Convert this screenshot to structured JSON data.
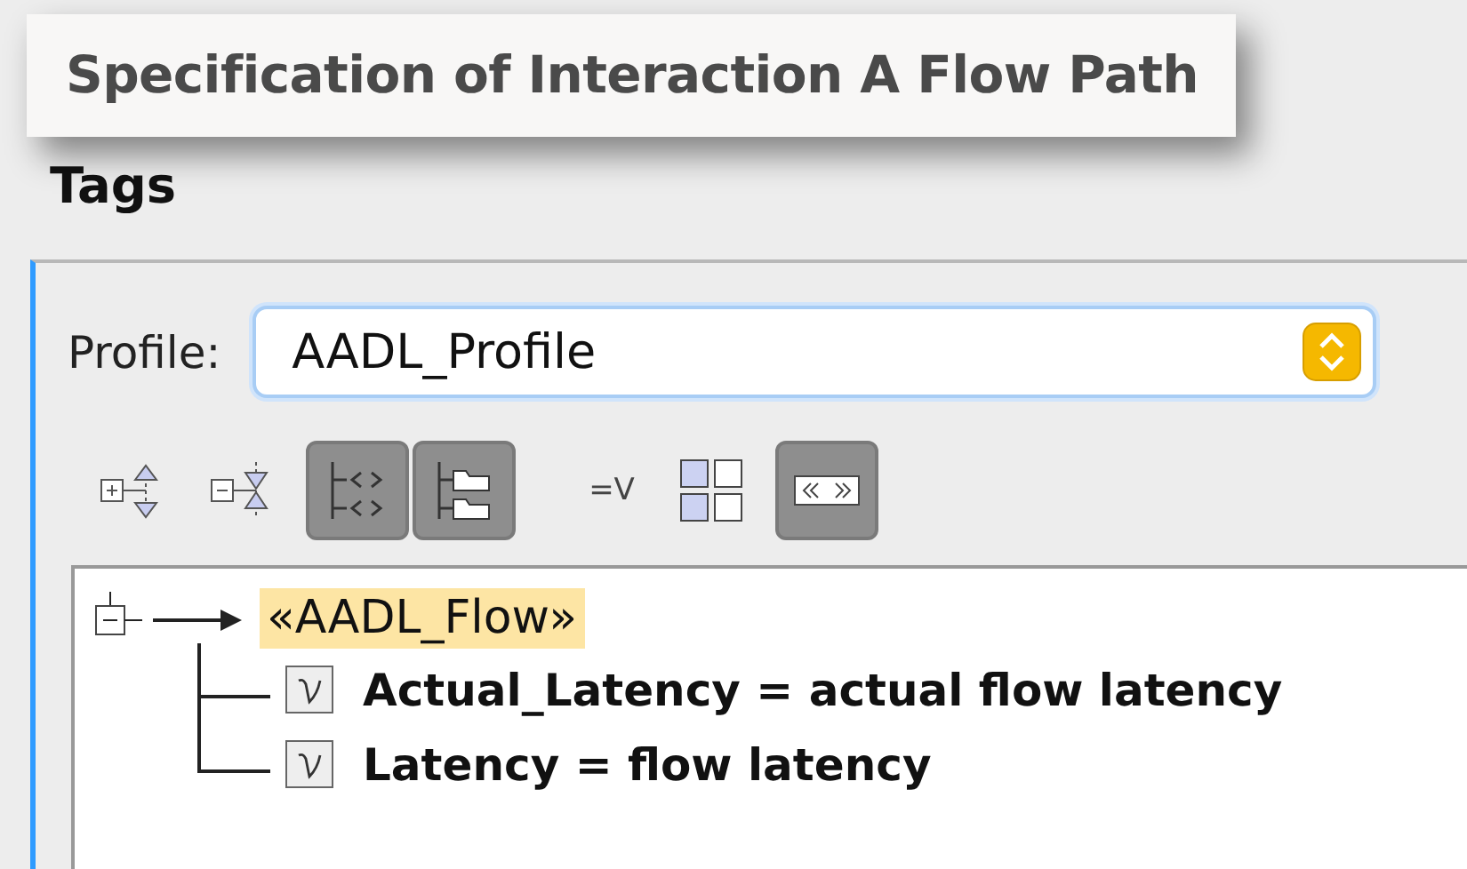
{
  "tooltip": {
    "title": "Specification of Interaction A Flow Path"
  },
  "panel": {
    "title": "Tags"
  },
  "profile": {
    "label": "Profile:",
    "value": "AADL_Profile"
  },
  "toolbar": [
    {
      "kind": "expand",
      "selected": false
    },
    {
      "kind": "collapse",
      "selected": false
    },
    {
      "kind": "brackets",
      "selected": true
    },
    {
      "kind": "folders",
      "selected": true
    },
    {
      "kind": "text",
      "label": "=V",
      "selected": false
    },
    {
      "kind": "grid",
      "selected": false
    },
    {
      "kind": "guillemets",
      "selected": true
    }
  ],
  "tree": [
    {
      "label": "«AADL_Flow»",
      "expanded": true,
      "selected": true,
      "children": [
        {
          "label": "Actual_Latency = actual flow latency"
        },
        {
          "label": "Latency = flow latency"
        }
      ]
    }
  ]
}
